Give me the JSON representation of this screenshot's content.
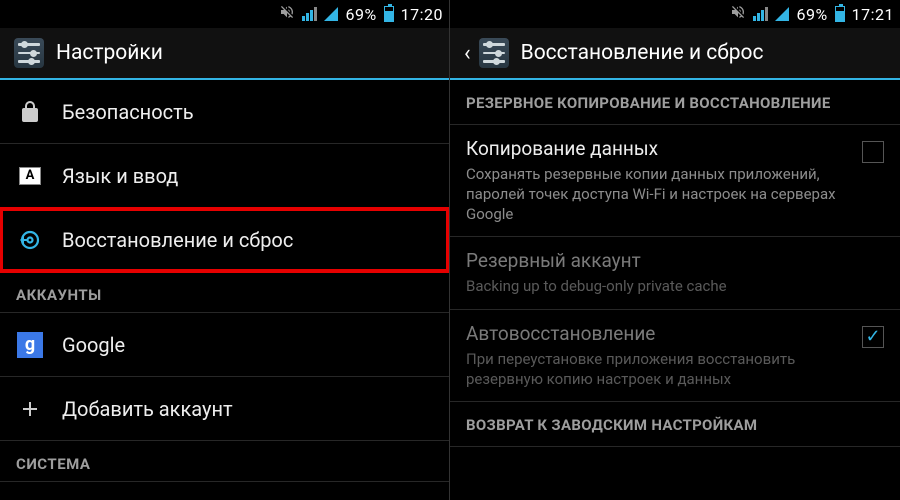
{
  "left": {
    "status": {
      "pct": "69%",
      "time": "17:20"
    },
    "title": "Настройки",
    "items": [
      {
        "label": "Безопасность"
      },
      {
        "label": "Язык и ввод",
        "langGlyph": "A"
      },
      {
        "label": "Восстановление и сброс",
        "highlighted": true
      }
    ],
    "section_accounts": "АККАУНТЫ",
    "accounts": [
      {
        "label": "Google",
        "glyph": "g"
      },
      {
        "label": "Добавить аккаунт"
      }
    ],
    "section_system": "СИСТЕМА"
  },
  "right": {
    "status": {
      "pct": "69%",
      "time": "17:21"
    },
    "title": "Восстановление и сброс",
    "section_backup": "РЕЗЕРВНОЕ КОПИРОВАНИЕ И ВОССТАНОВЛЕНИЕ",
    "prefs": [
      {
        "title": "Копирование данных",
        "sub": "Сохранять резервные копии данных приложений, паролей точек доступа Wi-Fi и настроек на серверах Google",
        "checkbox": true,
        "checked": false,
        "disabled": false
      },
      {
        "title": "Резервный аккаунт",
        "sub": "Backing up to debug-only private cache",
        "checkbox": false,
        "disabled": true
      },
      {
        "title": "Автовосстановление",
        "sub": "При переустановке приложения восстановить резервную копию настроек и данных",
        "checkbox": true,
        "checked": true,
        "disabled": true
      }
    ],
    "section_reset": "ВОЗВРАТ К ЗАВОДСКИМ НАСТРОЙКАМ"
  }
}
